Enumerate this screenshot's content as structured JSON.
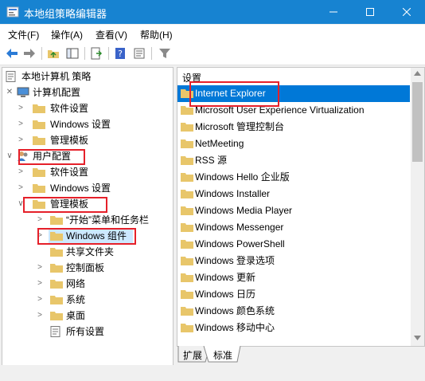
{
  "window": {
    "title": "本地组策略编辑器",
    "colors": {
      "titlebar": "#1783d1",
      "selection": "#0078d7",
      "folder": "#e8c66a",
      "highlight": "#e5202a"
    }
  },
  "menu": [
    "文件(F)",
    "操作(A)",
    "查看(V)",
    "帮助(H)"
  ],
  "toolbar_icons": [
    "back-icon",
    "forward-icon",
    "up-folder-icon",
    "show-hide-tree-icon",
    "export-list-icon",
    "help-icon",
    "properties-icon",
    "filter-icon"
  ],
  "tree": {
    "root": "本地计算机 策略",
    "computer_config": "计算机配置",
    "computer_children": [
      "软件设置",
      "Windows 设置",
      "管理模板"
    ],
    "user_config": "用户配置",
    "user_children": [
      "软件设置",
      "Windows 设置"
    ],
    "admin_templates": "管理模板",
    "admin_children": [
      "“开始”菜单和任务栏",
      "Windows 组件",
      "共享文件夹",
      "控制面板",
      "网络",
      "系统",
      "桌面",
      "所有设置"
    ]
  },
  "right": {
    "header": "设置",
    "items": [
      "Internet Explorer",
      "Microsoft User Experience Virtualization",
      "Microsoft 管理控制台",
      "NetMeeting",
      "RSS 源",
      "Windows Hello 企业版",
      "Windows Installer",
      "Windows Media Player",
      "Windows Messenger",
      "Windows PowerShell",
      "Windows 登录选项",
      "Windows 更新",
      "Windows 日历",
      "Windows 颜色系统",
      "Windows 移动中心"
    ]
  },
  "tabs": [
    "扩展",
    "标准"
  ]
}
